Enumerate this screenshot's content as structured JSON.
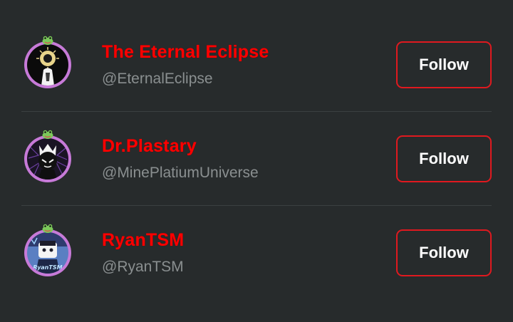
{
  "users": [
    {
      "name": "The Eternal Eclipse",
      "handle": "@EternalEclipse",
      "follow_label": "Follow"
    },
    {
      "name": "Dr.Plastary",
      "handle": "@MinePlatiumUniverse",
      "follow_label": "Follow"
    },
    {
      "name": "RyanTSM",
      "handle": "@RyanTSM",
      "follow_label": "Follow",
      "avatar_text": "RyanTSM"
    }
  ],
  "colors": {
    "background": "#272b2c",
    "name": "#ff0000",
    "handle": "#8a8f90",
    "button_border": "#e0191f",
    "avatar_ring": "#c77ad8",
    "divider": "#3b4041"
  },
  "icons": {
    "badge": "frog-badge-icon"
  }
}
